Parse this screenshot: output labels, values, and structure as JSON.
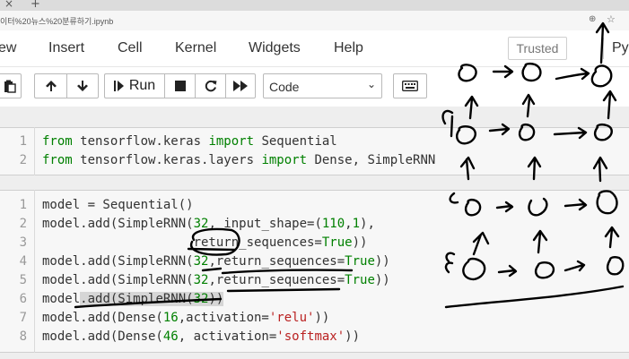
{
  "browser": {
    "url": "이터%20뉴스%20분류하기.ipynb",
    "zoom_icon": "zoom-icon",
    "star_icon": "star-icon"
  },
  "menu": {
    "items": [
      "ew",
      "Insert",
      "Cell",
      "Kernel",
      "Widgets",
      "Help"
    ],
    "trusted": "Trusted",
    "kernel": "Py"
  },
  "toolbar": {
    "run_label": "Run",
    "cell_type": "Code",
    "icons": [
      "paste-icon",
      "move-up-icon",
      "move-down-icon",
      "run-icon",
      "stop-icon",
      "restart-icon",
      "fast-forward-icon",
      "keyboard-icon"
    ]
  },
  "cells": [
    {
      "lines": [
        {
          "n": "1",
          "text": "from tensorflow.keras import Sequential"
        },
        {
          "n": "2",
          "text": "from tensorflow.keras.layers import Dense, SimpleRNN"
        }
      ]
    },
    {
      "lines": [
        {
          "n": "1",
          "text": "model = Sequential()"
        },
        {
          "n": "2",
          "text": "model.add(SimpleRNN(32, input_shape=(110,1),"
        },
        {
          "n": "3",
          "text": "                    return_sequences=True))"
        },
        {
          "n": "4",
          "text": "model.add(SimpleRNN(32,return_sequences=True))"
        },
        {
          "n": "5",
          "text": "model.add(SimpleRNN(32,return_sequences=True))"
        },
        {
          "n": "6",
          "text": "model.add(SimpleRNN(32))"
        },
        {
          "n": "7",
          "text": "model.add(Dense(16,activation='relu'))"
        },
        {
          "n": "8",
          "text": "model.add(Dense(46, activation='softmax'))"
        }
      ]
    }
  ]
}
